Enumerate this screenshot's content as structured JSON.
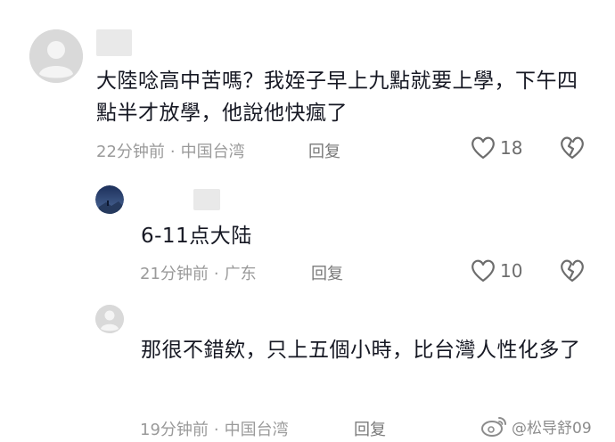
{
  "comments": [
    {
      "text": "大陸唸高中苦嗎？我姪子早上九點就要上學，下午四點半才放學，他說他快瘋了",
      "time": "22分钟前",
      "location": "中国台湾",
      "reply_label": "回复",
      "likes": "18",
      "avatar_icon": "default-user-avatar-icon"
    },
    {
      "text": "6-11点大陆",
      "time": "21分钟前",
      "location": "广东",
      "reply_label": "回复",
      "likes": "10",
      "avatar_icon": "night-sky-avatar-icon"
    },
    {
      "text": "那很不錯欸，只上五個小時，比台灣人性化多了",
      "time": "19分钟前",
      "location": "中国台湾",
      "reply_label": "回复",
      "avatar_icon": "small-user-avatar-icon"
    }
  ],
  "separator": "·",
  "watermark": {
    "text": "@松导舒09",
    "icon": "weibo-logo-icon"
  }
}
